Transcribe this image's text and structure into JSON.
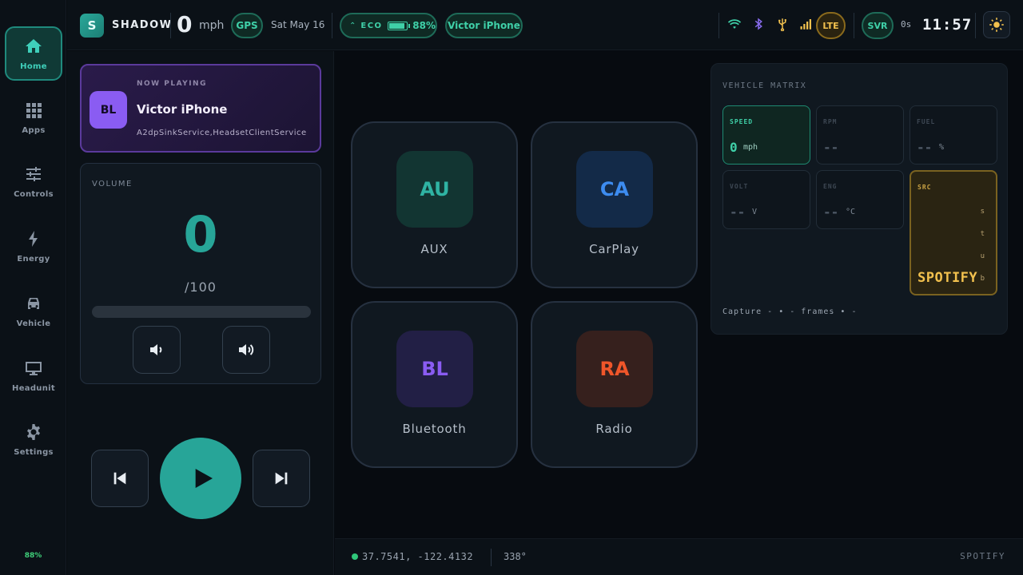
{
  "app": {
    "logo_letter": "S",
    "brand": "SHADOW"
  },
  "sidebar": {
    "items": [
      {
        "label": "Home",
        "icon": "home-icon",
        "active": true
      },
      {
        "label": "Apps",
        "icon": "grid-icon"
      },
      {
        "label": "Controls",
        "icon": "sliders-icon"
      },
      {
        "label": "Energy",
        "icon": "bolt-icon"
      },
      {
        "label": "Vehicle",
        "icon": "car-icon"
      },
      {
        "label": "Headunit",
        "icon": "monitor-icon"
      },
      {
        "label": "Settings",
        "icon": "gear-icon"
      }
    ],
    "battery": "88%"
  },
  "topbar": {
    "speed": "0",
    "speed_unit": "mph",
    "gps": "GPS",
    "date": "Sat May 16",
    "eco_label": "ECO",
    "battery_pct": "88%",
    "battery_level": 0.88,
    "device": "Victor iPhone",
    "lte": "LTE",
    "svr": "SVR",
    "latency": "0s",
    "clock": "11:57",
    "status_icons": [
      "wifi-icon",
      "bluetooth-icon",
      "usb-icon",
      "signal-icon"
    ],
    "theme_icon": "sun-icon"
  },
  "now_playing": {
    "kicker": "NOW PLAYING",
    "avatar": "BL",
    "title": "Victor iPhone",
    "subtitle": "A2dpSinkService,HeadsetClientService"
  },
  "volume": {
    "kicker": "VOLUME",
    "value": "0",
    "max_label": "/100",
    "level": 0
  },
  "sources": [
    {
      "abbr": "AU",
      "label": "AUX",
      "bg": "#123532",
      "fg": "#2fb3a3"
    },
    {
      "abbr": "CA",
      "label": "CarPlay",
      "bg": "#132a48",
      "fg": "#3d8cf0"
    },
    {
      "abbr": "BL",
      "label": "Bluetooth",
      "bg": "#221f45",
      "fg": "#8a5cf2"
    },
    {
      "abbr": "RA",
      "label": "Radio",
      "bg": "#36201d",
      "fg": "#f0562a"
    }
  ],
  "matrix": {
    "title": "VEHICLE MATRIX",
    "speed": {
      "label": "SPEED",
      "value": "0",
      "unit": "mph"
    },
    "rpm": {
      "label": "RPM",
      "value": "--"
    },
    "fuel": {
      "label": "FUEL",
      "value": "--",
      "unit": "%"
    },
    "volt": {
      "label": "VOLT",
      "value": "--",
      "unit": "V"
    },
    "eng": {
      "label": "ENG",
      "value": "--",
      "unit": "°C"
    },
    "src": {
      "label": "SRC",
      "stub": [
        "s",
        "t",
        "u",
        "b"
      ],
      "value": "SPOTIFY"
    },
    "capture": "Capture - • - frames • -"
  },
  "bottombar": {
    "coords": "37.7541, -122.4132",
    "heading": "338°",
    "source": "SPOTIFY"
  },
  "colors": {
    "accent": "#27a598",
    "warning": "#f2c14e",
    "purple": "#8a5cf2"
  }
}
